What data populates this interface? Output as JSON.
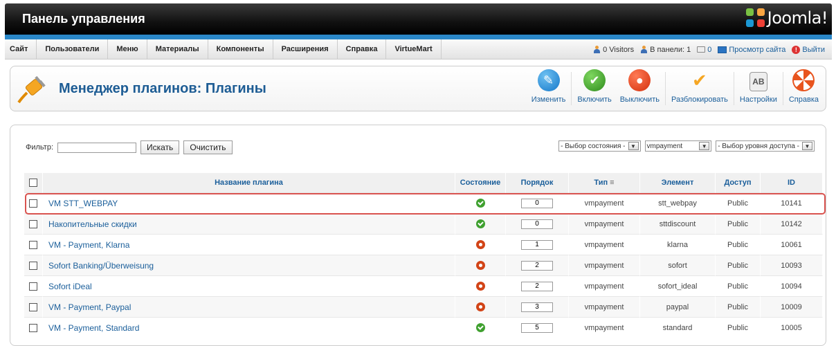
{
  "header": {
    "title": "Панель управления",
    "logo_text": "Joomla!"
  },
  "menu": [
    "Сайт",
    "Пользователи",
    "Меню",
    "Материалы",
    "Компоненты",
    "Расширения",
    "Справка",
    "VirtueMart"
  ],
  "status": {
    "visitors": "0 Visitors",
    "admins": "В панели: 1",
    "messages": "0",
    "view_site": "Просмотр сайта",
    "logout": "Выйти"
  },
  "page": {
    "title": "Менеджер плагинов: Плагины"
  },
  "toolbar": {
    "edit": "Изменить",
    "enable": "Включить",
    "disable": "Выключить",
    "unlock": "Разблокировать",
    "settings": "Настройки",
    "help": "Справка"
  },
  "filter": {
    "label": "Фильтр:",
    "value": "",
    "search": "Искать",
    "clear": "Очистить",
    "state_select": "- Выбор состояния -",
    "type_select": "vmpayment",
    "access_select": "- Выбор уровня доступа -"
  },
  "table": {
    "headers": {
      "name": "Название плагина",
      "state": "Состояние",
      "order": "Порядок",
      "type": "Тип",
      "element": "Элемент",
      "access": "Доступ",
      "id": "ID"
    },
    "rows": [
      {
        "name": "VM STT_WEBPAY",
        "enabled": true,
        "order": "0",
        "type": "vmpayment",
        "element": "stt_webpay",
        "access": "Public",
        "id": "10141"
      },
      {
        "name": "Накопительные скидки",
        "enabled": true,
        "order": "0",
        "type": "vmpayment",
        "element": "sttdiscount",
        "access": "Public",
        "id": "10142"
      },
      {
        "name": "VM - Payment, Klarna",
        "enabled": false,
        "order": "1",
        "type": "vmpayment",
        "element": "klarna",
        "access": "Public",
        "id": "10061"
      },
      {
        "name": "Sofort Banking/Überweisung",
        "enabled": false,
        "order": "2",
        "type": "vmpayment",
        "element": "sofort",
        "access": "Public",
        "id": "10093"
      },
      {
        "name": "Sofort iDeal",
        "enabled": false,
        "order": "2",
        "type": "vmpayment",
        "element": "sofort_ideal",
        "access": "Public",
        "id": "10094"
      },
      {
        "name": "VM - Payment, Paypal",
        "enabled": false,
        "order": "3",
        "type": "vmpayment",
        "element": "paypal",
        "access": "Public",
        "id": "10009"
      },
      {
        "name": "VM - Payment, Standard",
        "enabled": true,
        "order": "5",
        "type": "vmpayment",
        "element": "standard",
        "access": "Public",
        "id": "10005"
      }
    ]
  },
  "colors": {
    "accent": "#2a87c8",
    "link": "#1a5e9a",
    "highlight": "#d9534f",
    "enabled": "#3fa02f",
    "disabled": "#d24417"
  }
}
